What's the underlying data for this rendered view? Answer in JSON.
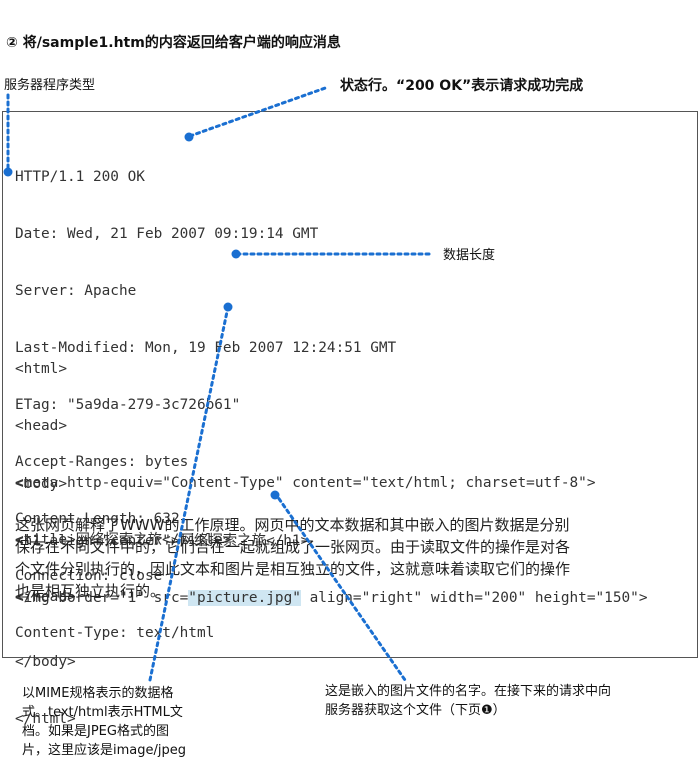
{
  "title": "② 将/sample1.htm的内容返回给客户端的响应消息",
  "annotations": {
    "server_type": "服务器程序类型",
    "status_line": "状态行。“200 OK”表示请求成功完成",
    "data_length": "数据长度",
    "mime_type": [
      "以MIME规格表示的数据格",
      "式。text/html表示HTML文",
      "档。如果是JPEG格式的图",
      "片，这里应该是image/jpeg"
    ],
    "image_name": [
      "这是嵌入的图片文件的名字。在接下来的请求中向",
      "服务器获取这个文件（下页❶）"
    ]
  },
  "headers": [
    "HTTP/1.1 200 OK",
    "Date: Wed, 21 Feb 2007 09:19:14 GMT",
    "Server: Apache",
    "Last-Modified: Mon, 19 Feb 2007 12:24:51 GMT",
    "ETag: \"5a9da-279-3c726b61\"",
    "Accept-Ranges: bytes",
    "Content-Length: 632",
    "Connection: close",
    "Content-Type: text/html"
  ],
  "html_head": [
    "<html>",
    "<head>",
    "<meta http-equiv=\"Content-Type\" content=\"text/html; charset=utf-8\">",
    "<title>网络探索之旅</title>",
    "</head>"
  ],
  "html_body_start": [
    "<body>",
    "<h1 align=\"center\">网络探索之旅</h1>"
  ],
  "img_line": {
    "before": "<img border=\"1\" src=",
    "highlight": "\"picture.jpg\"",
    "after": " align=\"right\" width=\"200\" height=\"150\">"
  },
  "paragraph": [
    "这张网页解释了WWW的工作原理。网页中的文本数据和其中嵌入的图片数据是分别",
    "保存在不同文件中的，它们合在一起就组成了一张网页。由于读取文件的操作是对各",
    "个文件分别执行的，因此文本和图片是相互独立的文件，这就意味着读取它们的操作",
    "也是相互独立执行的。"
  ],
  "html_end": [
    "</body>",
    "</html>"
  ],
  "colors": {
    "callout": "#1a6fd1",
    "highlight": "#cfe6f2",
    "border": "#555555"
  }
}
